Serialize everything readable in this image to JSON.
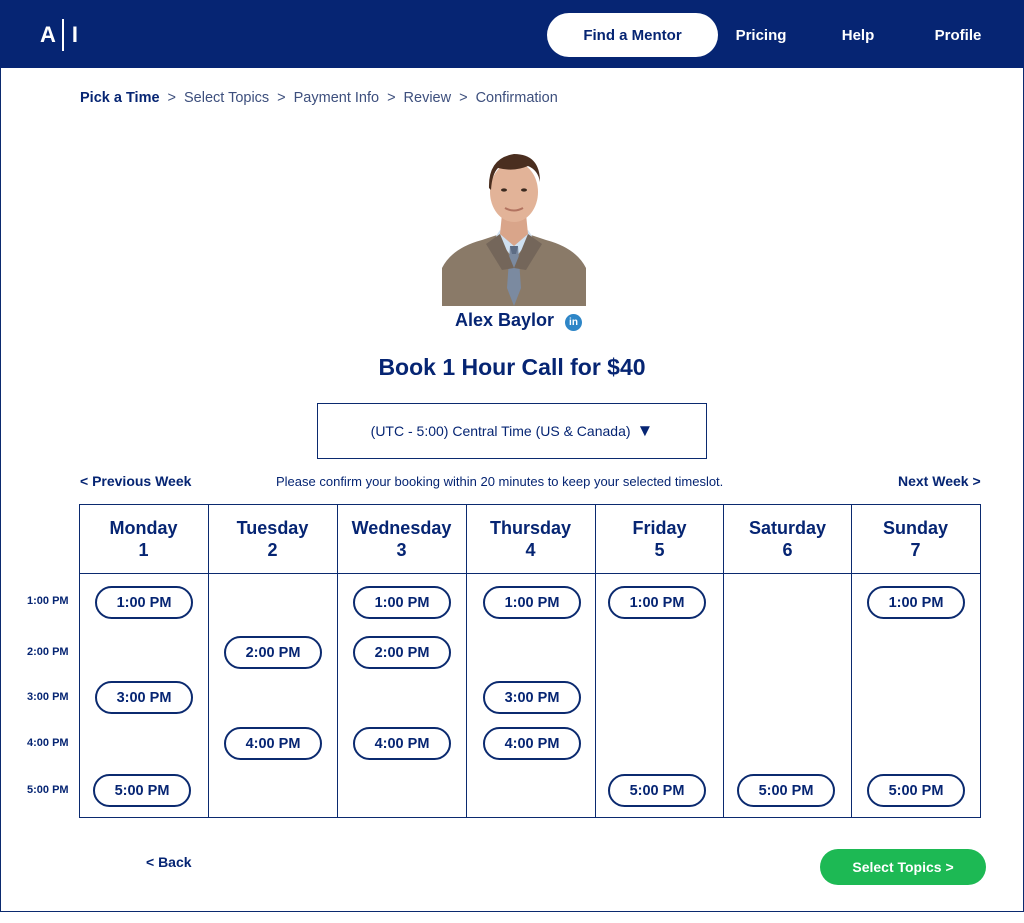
{
  "header": {
    "logo_left": "A",
    "logo_right": "I",
    "nav": {
      "find_mentor": "Find a Mentor",
      "pricing": "Pricing",
      "help": "Help",
      "profile": "Profile"
    }
  },
  "breadcrumb": {
    "step1": "Pick a Time",
    "step2": "Select Topics",
    "step3": "Payment Info",
    "step4": "Review",
    "step5": "Confirmation",
    "separator": ">"
  },
  "mentor": {
    "name": "Alex Baylor",
    "linkedin_icon": "in",
    "photo": "mentor-headshot"
  },
  "booking": {
    "title": "Book 1 Hour Call for $40",
    "timezone": "(UTC - 5:00) Central Time (US & Canada)",
    "timezone_arrow": "▼",
    "prev_week": "<  Previous Week",
    "next_week": "Next Week  >",
    "note": "Please confirm your booking within 20 minutes to keep your selected timeslot."
  },
  "calendar": {
    "days": [
      {
        "name": "Monday",
        "num": "1"
      },
      {
        "name": "Tuesday",
        "num": "2"
      },
      {
        "name": "Wednesday",
        "num": "3"
      },
      {
        "name": "Thursday",
        "num": "4"
      },
      {
        "name": "Friday",
        "num": "5"
      },
      {
        "name": "Saturday",
        "num": "6"
      },
      {
        "name": "Sunday",
        "num": "7"
      }
    ],
    "time_labels": [
      "1:00 PM",
      "2:00 PM",
      "3:00 PM",
      "4:00 PM",
      "5:00 PM"
    ],
    "slots": {
      "mon_1": "1:00 PM",
      "mon_3": "3:00 PM",
      "mon_5": "5:00 PM",
      "tue_2": "2:00 PM",
      "tue_4": "4:00 PM",
      "wed_1": "1:00 PM",
      "wed_2": "2:00 PM",
      "wed_4": "4:00 PM",
      "thu_1": "1:00 PM",
      "thu_3": "3:00 PM",
      "thu_4": "4:00 PM",
      "fri_1": "1:00 PM",
      "fri_5": "5:00 PM",
      "sat_5": "5:00 PM",
      "sun_1": "1:00 PM",
      "sun_5": "5:00 PM"
    }
  },
  "footer": {
    "back": "<  Back",
    "next": "Select Topics  >"
  },
  "colors": {
    "navy": "#062573",
    "green": "#1db954",
    "linkedin": "#2e86c7"
  }
}
